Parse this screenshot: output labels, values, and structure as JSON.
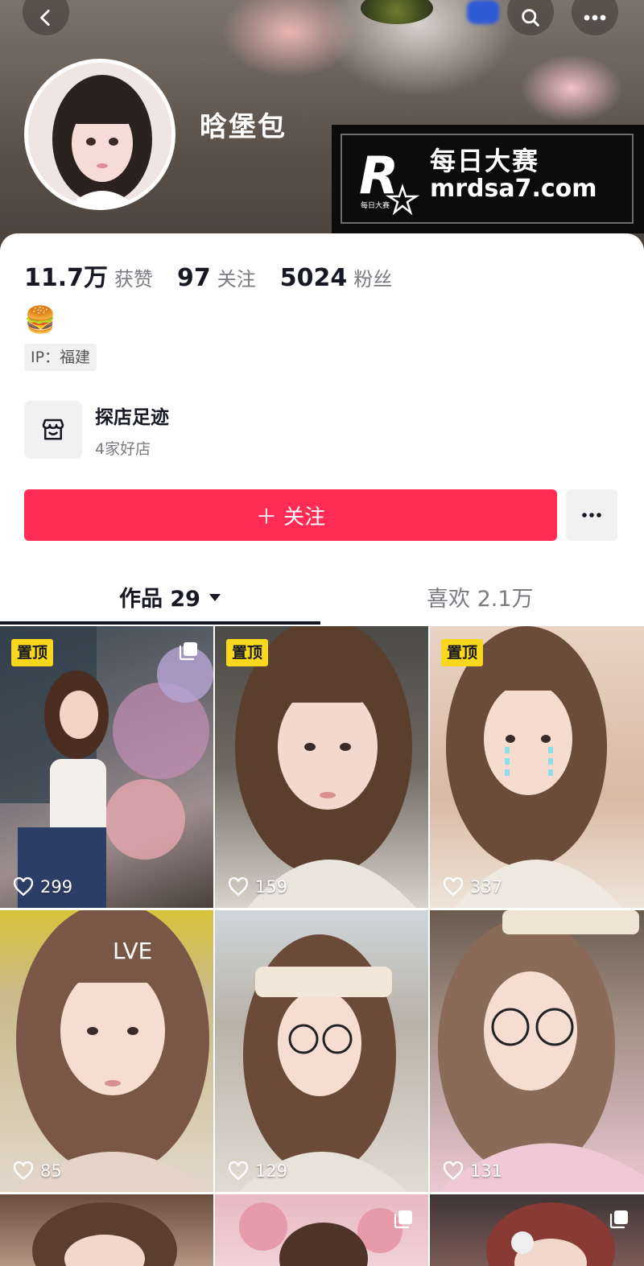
{
  "profile": {
    "name": "晗堡包",
    "bio_emoji": "🍔",
    "ip_label": "IP：福建"
  },
  "stats": {
    "likes_value": "11.7万",
    "likes_label": "获赞",
    "following_value": "97",
    "following_label": "关注",
    "followers_value": "5024",
    "followers_label": "粉丝"
  },
  "shop": {
    "title": "探店足迹",
    "subtitle": "4家好店"
  },
  "actions": {
    "follow_label": "＋ 关注"
  },
  "tabs": {
    "works_label": "作品 29",
    "likes_label": "喜欢 2.1万"
  },
  "watermark": {
    "title": "每日大赛",
    "url": "mrdsa7.com",
    "logo_letter": "R",
    "logo_caption": "每日大赛"
  },
  "videos": [
    {
      "pinned_label": "置顶",
      "likes": "299"
    },
    {
      "pinned_label": "置顶",
      "likes": "159"
    },
    {
      "pinned_label": "置顶",
      "likes": "337"
    },
    {
      "likes": "85",
      "overlay_text": "LVE"
    },
    {
      "likes": "129"
    },
    {
      "likes": "131"
    }
  ],
  "icons": {
    "back": "chevron-left-icon",
    "search": "search-icon",
    "more": "more-dots-icon",
    "shop": "shop-icon",
    "heart": "heart-icon",
    "multi": "multi-image-icon"
  },
  "colors": {
    "accent": "#fe2c55",
    "pin": "#f8d71c",
    "text": "#161823",
    "muted": "#7a7b80"
  }
}
